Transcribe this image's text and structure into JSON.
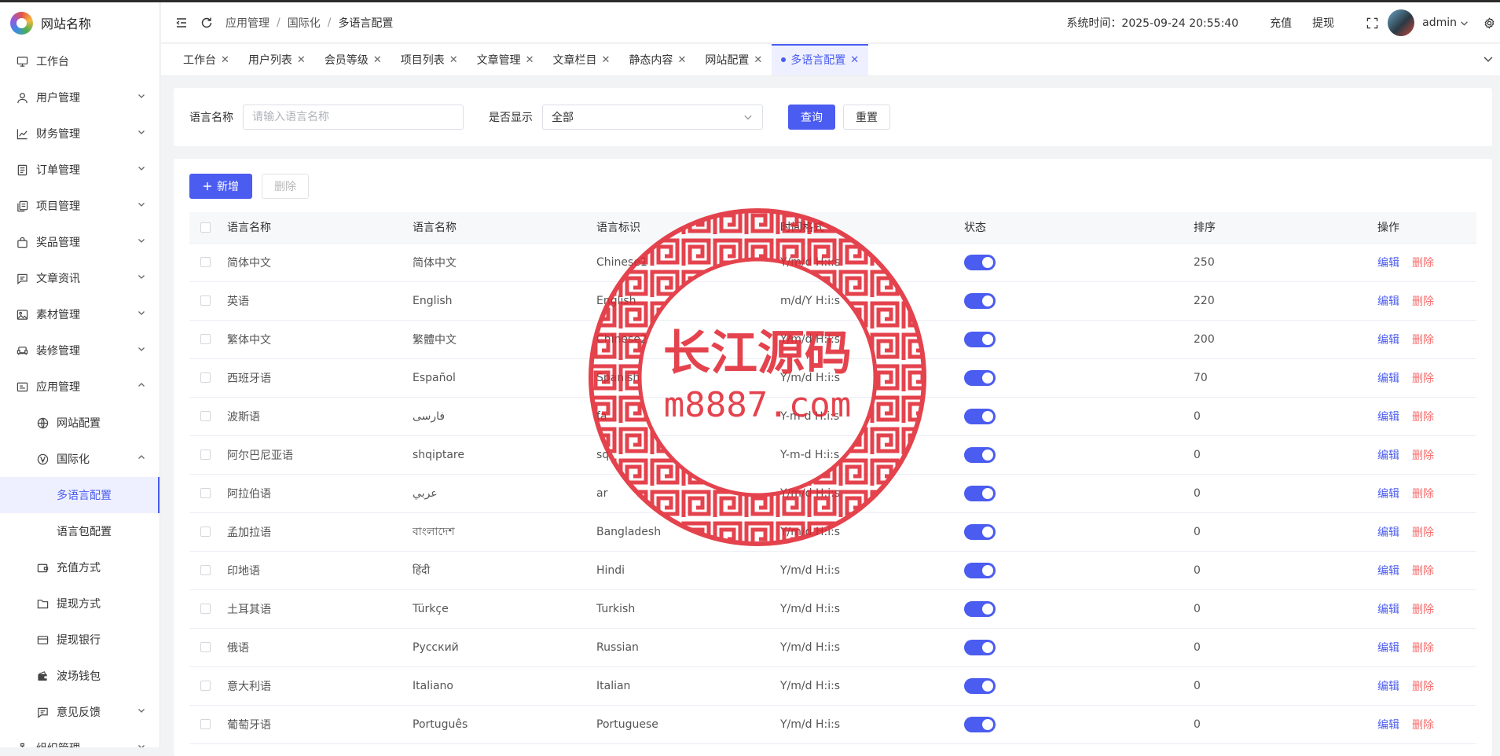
{
  "brand": {
    "name": "网站名称"
  },
  "sidebar": {
    "items": [
      {
        "label": "工作台",
        "icon": "monitor-icon"
      },
      {
        "label": "用户管理",
        "icon": "user-icon"
      },
      {
        "label": "财务管理",
        "icon": "chart-icon"
      },
      {
        "label": "订单管理",
        "icon": "document-icon"
      },
      {
        "label": "项目管理",
        "icon": "copy-icon"
      },
      {
        "label": "奖品管理",
        "icon": "bag-icon"
      },
      {
        "label": "文章资讯",
        "icon": "message-icon"
      },
      {
        "label": "素材管理",
        "icon": "image-icon"
      },
      {
        "label": "装修管理",
        "icon": "sofa-icon"
      },
      {
        "label": "应用管理",
        "icon": "app-icon"
      },
      {
        "label": "网站配置",
        "icon": "globe-icon"
      },
      {
        "label": "国际化",
        "icon": "language-icon"
      },
      {
        "label": "多语言配置"
      },
      {
        "label": "语言包配置"
      },
      {
        "label": "充值方式",
        "icon": "wallet-icon"
      },
      {
        "label": "提现方式",
        "icon": "folder-icon"
      },
      {
        "label": "提现银行",
        "icon": "card-icon"
      },
      {
        "label": "波场钱包",
        "icon": "wallet-filled-icon"
      },
      {
        "label": "意见反馈",
        "icon": "feedback-icon"
      },
      {
        "label": "组织管理",
        "icon": "org-icon"
      }
    ]
  },
  "header": {
    "breadcrumb": [
      "应用管理",
      "国际化",
      "多语言配置"
    ],
    "system_time": "系统时间：2025-09-24 20:55:40",
    "recharge": "充值",
    "withdraw": "提现",
    "username": "admin"
  },
  "tabs": [
    {
      "label": "工作台"
    },
    {
      "label": "用户列表"
    },
    {
      "label": "会员等级"
    },
    {
      "label": "项目列表"
    },
    {
      "label": "文章管理"
    },
    {
      "label": "文章栏目"
    },
    {
      "label": "静态内容"
    },
    {
      "label": "网站配置"
    },
    {
      "label": "多语言配置",
      "active": true
    }
  ],
  "search": {
    "name_label": "语言名称",
    "name_placeholder": "请输入语言名称",
    "show_label": "是否显示",
    "show_value": "全部",
    "query": "查询",
    "reset": "重置"
  },
  "toolbar": {
    "add": "新增",
    "delete": "删除"
  },
  "table": {
    "headers": [
      "语言名称",
      "语言名称",
      "语言标识",
      "时间格式",
      "状态",
      "排序",
      "操作"
    ],
    "edit": "编辑",
    "delete": "删除",
    "rows": [
      {
        "name": "简体中文",
        "native": "简体中文",
        "code": "Chinese1",
        "format": "Y/m/d H:i:s",
        "enabled": true,
        "sort": "250"
      },
      {
        "name": "英语",
        "native": "English",
        "code": "English",
        "format": "m/d/Y H:i:s",
        "enabled": true,
        "sort": "220"
      },
      {
        "name": "繁体中文",
        "native": "繁體中文",
        "code": "Chinese2",
        "format": "Y/m/d H:i:s",
        "enabled": true,
        "sort": "200"
      },
      {
        "name": "西班牙语",
        "native": "Español",
        "code": "Spanish",
        "format": "Y/m/d H:i:s",
        "enabled": true,
        "sort": "70"
      },
      {
        "name": "波斯语",
        "native": "فارسی",
        "code": "fa",
        "format": "Y-m-d H:i:s",
        "enabled": true,
        "sort": "0"
      },
      {
        "name": "阿尔巴尼亚语",
        "native": "shqiptare",
        "code": "sq",
        "format": "Y-m-d H:i:s",
        "enabled": true,
        "sort": "0"
      },
      {
        "name": "阿拉伯语",
        "native": "عربي",
        "code": "ar",
        "format": "Y/m/d H:i:s",
        "enabled": true,
        "sort": "0"
      },
      {
        "name": "孟加拉语",
        "native": "বাংলাদেশ",
        "code": "Bangladesh",
        "format": "Y/m/d H:i:s",
        "enabled": true,
        "sort": "0"
      },
      {
        "name": "印地语",
        "native": "हिंदी",
        "code": "Hindi",
        "format": "Y/m/d H:i:s",
        "enabled": true,
        "sort": "0"
      },
      {
        "name": "土耳其语",
        "native": "Türkçe",
        "code": "Turkish",
        "format": "Y/m/d H:i:s",
        "enabled": true,
        "sort": "0"
      },
      {
        "name": "俄语",
        "native": "Русский",
        "code": "Russian",
        "format": "Y/m/d H:i:s",
        "enabled": true,
        "sort": "0"
      },
      {
        "name": "意大利语",
        "native": "Italiano",
        "code": "Italian",
        "format": "Y/m/d H:i:s",
        "enabled": true,
        "sort": "0"
      },
      {
        "name": "葡萄牙语",
        "native": "Português",
        "code": "Portuguese",
        "format": "Y/m/d H:i:s",
        "enabled": true,
        "sort": "0"
      }
    ]
  },
  "watermark": {
    "title": "长江源码",
    "url": "m8887.com",
    "color": "#e0232e"
  },
  "colors": {
    "accent": "#4b5cf0",
    "danger": "#f56c6c"
  }
}
